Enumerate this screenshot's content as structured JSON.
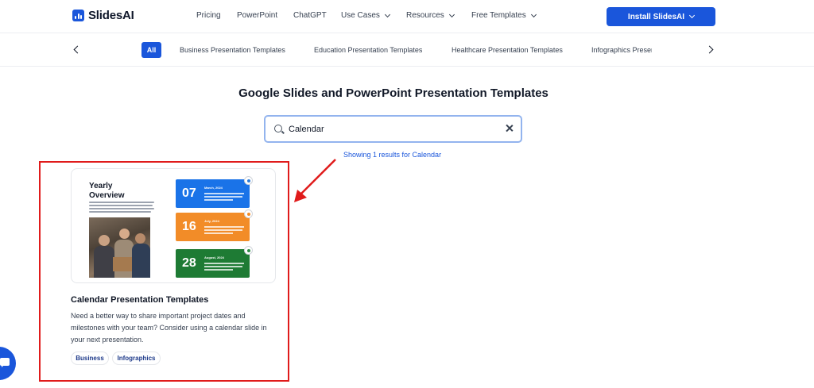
{
  "brand": {
    "name": "SlidesAI",
    "accent": "#1a56db"
  },
  "nav": {
    "links": [
      {
        "label": "Pricing"
      },
      {
        "label": "PowerPoint"
      },
      {
        "label": "ChatGPT"
      },
      {
        "label": "Use Cases",
        "dropdown": true
      },
      {
        "label": "Resources",
        "dropdown": true
      },
      {
        "label": "Free Templates",
        "dropdown": true
      }
    ],
    "install_label": "Install SlidesAI"
  },
  "categories": {
    "active": "All",
    "items": [
      "Business Presentation Templates",
      "Education Presentation Templates",
      "Healthcare Presentation Templates"
    ],
    "clipped": "Infographics Presentation Templates"
  },
  "main": {
    "title": "Google Slides and PowerPoint Presentation Templates",
    "search": {
      "value": "Calendar"
    },
    "results_text": "Showing 1 results for Calendar"
  },
  "card": {
    "thumbnail": {
      "heading": "Yearly Overview",
      "dates": [
        {
          "day": "07",
          "label": "March, 2024",
          "color": "#1a73e8",
          "badge": "#2b7bd8"
        },
        {
          "day": "16",
          "label": "July, 2024",
          "color": "#f28c28",
          "badge": "#f28c28"
        },
        {
          "day": "28",
          "label": "August, 2024",
          "color": "#1e7b34",
          "badge": "#2e8b45"
        }
      ]
    },
    "title": "Calendar Presentation Templates",
    "description": "Need a better way to share important project dates and milestones with your team? Consider using a calendar slide in your next presentation.",
    "tags": [
      "Business",
      "Infographics"
    ],
    "highlight_color": "#e01b1b"
  }
}
